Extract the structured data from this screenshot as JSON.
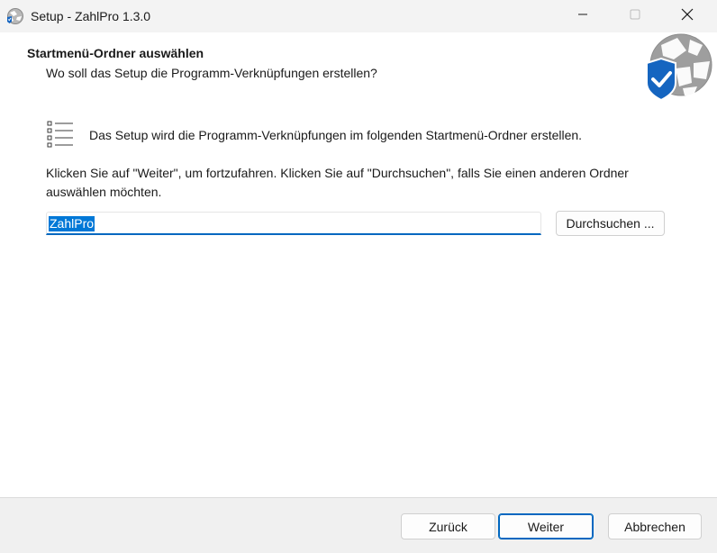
{
  "window": {
    "title": "Setup - ZahlPro 1.3.0",
    "icons": {
      "app": "setup-globe-icon",
      "minimize": "minimize-icon",
      "maximize": "maximize-icon",
      "close": "close-icon"
    }
  },
  "header": {
    "title": "Startmenü-Ordner auswählen",
    "subtitle": "Wo soll das Setup die Programm-Verknüpfungen erstellen?",
    "logo_icon": "globe-shield-check-icon"
  },
  "body": {
    "list_icon": "list-icon",
    "description": "Das Setup wird die Programm-Verknüpfungen im folgenden Startmenü-Ordner erstellen.",
    "instructions": "Klicken Sie auf \"Weiter\", um fortzufahren. Klicken Sie auf \"Durchsuchen\", falls Sie einen anderen Ordner auswählen möchten.",
    "folder_value": "ZahlPro",
    "browse_label": "Durchsuchen ..."
  },
  "footer": {
    "back_label": "Zurück",
    "next_label": "Weiter",
    "cancel_label": "Abbrechen"
  },
  "colors": {
    "accent": "#0067c0",
    "selection": "#0078d7",
    "shield": "#1565c0",
    "titlebar": "#f3f3f3",
    "footer": "#f0f0f0"
  }
}
